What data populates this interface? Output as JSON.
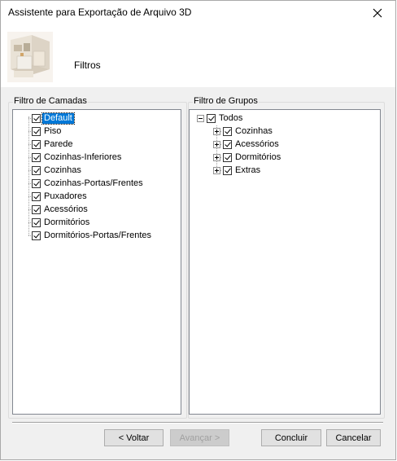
{
  "window": {
    "title": "Assistente para Exportação de Arquivo 3D"
  },
  "header": {
    "title": "Filtros"
  },
  "layers": {
    "label": "Filtro de Camadas",
    "items": [
      {
        "label": "Default",
        "selected": true
      },
      {
        "label": "Piso"
      },
      {
        "label": "Parede"
      },
      {
        "label": "Cozinhas-Inferiores"
      },
      {
        "label": "Cozinhas"
      },
      {
        "label": "Cozinhas-Portas/Frentes"
      },
      {
        "label": "Puxadores"
      },
      {
        "label": "Acessórios"
      },
      {
        "label": "Dormitórios"
      },
      {
        "label": "Dormitórios-Portas/Frentes"
      }
    ]
  },
  "groups": {
    "label": "Filtro de Grupos",
    "root": "Todos",
    "children": [
      "Cozinhas",
      "Acessórios",
      "Dormitórios",
      "Extras"
    ]
  },
  "buttons": {
    "back": "< Voltar",
    "next": "Avançar >",
    "finish": "Concluir",
    "cancel": "Cancelar"
  }
}
